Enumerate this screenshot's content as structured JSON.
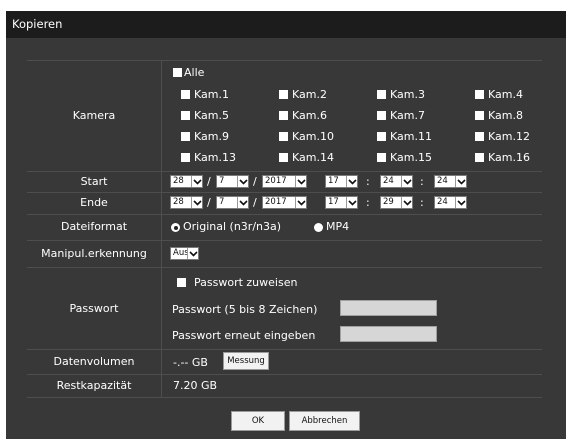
{
  "window": {
    "title": "Kopieren"
  },
  "kamera": {
    "label": "Kamera",
    "all": "Alle",
    "cams": [
      "Kam.1",
      "Kam.2",
      "Kam.3",
      "Kam.4",
      "Kam.5",
      "Kam.6",
      "Kam.7",
      "Kam.8",
      "Kam.9",
      "Kam.10",
      "Kam.11",
      "Kam.12",
      "Kam.13",
      "Kam.14",
      "Kam.15",
      "Kam.16"
    ]
  },
  "start": {
    "label": "Start",
    "day": "28",
    "month": "7",
    "year": "2017",
    "hour": "17",
    "minute": "24",
    "second": "24"
  },
  "ende": {
    "label": "Ende",
    "day": "28",
    "month": "7",
    "year": "2017",
    "hour": "17",
    "minute": "29",
    "second": "24"
  },
  "separators": {
    "date": "/",
    "time": ":"
  },
  "dateiformat": {
    "label": "Dateiformat",
    "original": "Original (n3r/n3a)",
    "mp4": "MP4",
    "selected": "original"
  },
  "manipul": {
    "label": "Manipul.erkennung",
    "value": "Aus"
  },
  "passwort": {
    "label": "Passwort",
    "assign_label": "Passwort zuweisen",
    "pw_label": "Passwort (5 bis 8 Zeichen)",
    "pw_repeat_label": "Passwort erneut eingeben"
  },
  "datenvolumen": {
    "label": "Datenvolumen",
    "value": "-.-- GB",
    "measure_button": "Messung"
  },
  "restkapazitaet": {
    "label": "Restkapazität",
    "value": "7.20 GB"
  },
  "footer": {
    "ok": "OK",
    "cancel": "Abbrechen"
  },
  "colors": {
    "dialog_bg": "#383838",
    "titlebar_bg": "#1c1c1c",
    "separator": "#4e4e4e",
    "field_gray": "#d6d6d6"
  }
}
